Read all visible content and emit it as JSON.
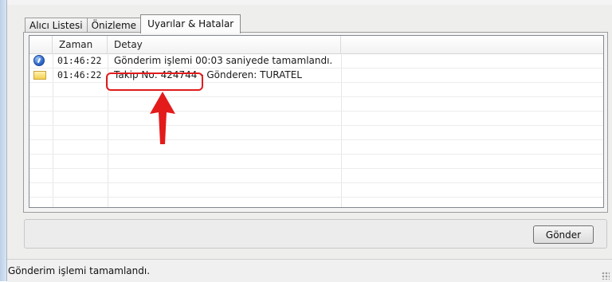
{
  "tabs": [
    {
      "label": "Alıcı Listesi",
      "active": false
    },
    {
      "label": "Önizleme",
      "active": false
    },
    {
      "label": "Uyarılar & Hatalar",
      "active": true
    }
  ],
  "grid": {
    "columns": [
      "",
      "Zaman",
      "Detay",
      ""
    ],
    "rows": [
      {
        "icon": "info-icon",
        "time": "01:46:22",
        "detail": "Gönderim işlemi 00:03 saniyede tamamlandı."
      },
      {
        "icon": "mail-icon",
        "time": "01:46:22",
        "detail_highlight": "Takip No: 424744",
        "detail_rest": "- Gönderen: TURATEL"
      }
    ]
  },
  "buttons": {
    "send_label": "Gönder"
  },
  "status": {
    "text": "Gönderim işlemi tamamlandı."
  },
  "colors": {
    "highlight": "#e01b1b",
    "arrow": "#e31b1b"
  }
}
